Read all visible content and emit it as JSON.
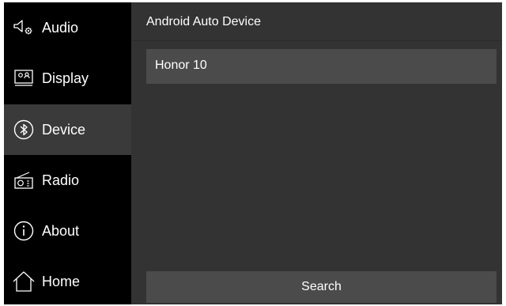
{
  "sidebar": {
    "items": [
      {
        "label": "Audio",
        "icon": "speaker-settings-icon",
        "active": false
      },
      {
        "label": "Display",
        "icon": "display-icon",
        "active": false
      },
      {
        "label": "Device",
        "icon": "bluetooth-icon",
        "active": true
      },
      {
        "label": "Radio",
        "icon": "radio-icon",
        "active": false
      },
      {
        "label": "About",
        "icon": "info-icon",
        "active": false
      },
      {
        "label": "Home",
        "icon": "home-icon",
        "active": false
      }
    ]
  },
  "main": {
    "title": "Android Auto Device",
    "devices": [
      {
        "name": "Honor 10"
      }
    ],
    "search_label": "Search"
  },
  "colors": {
    "sidebar_bg": "#000000",
    "sidebar_active_bg": "#3a3a3a",
    "main_bg": "#333333",
    "row_bg": "#4b4b4b",
    "text": "#ffffff"
  }
}
